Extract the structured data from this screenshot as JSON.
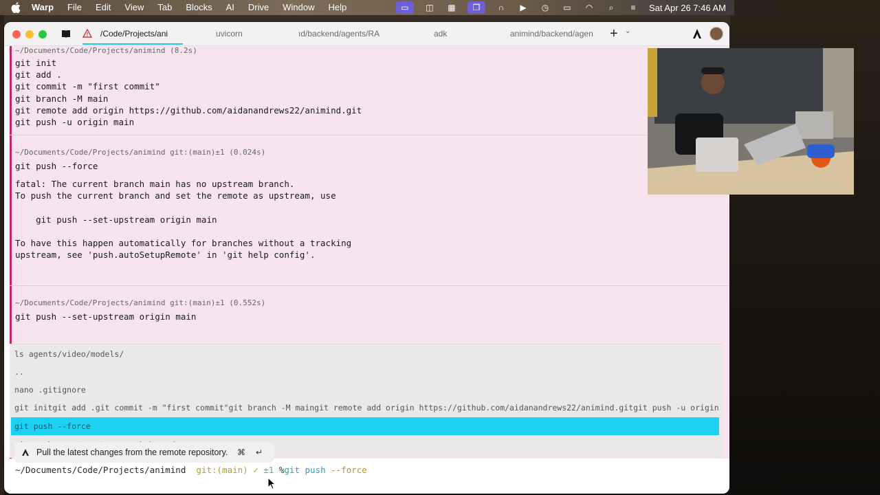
{
  "menubar": {
    "app_name": "Warp",
    "menus": [
      "File",
      "Edit",
      "View",
      "Tab",
      "Blocks",
      "AI",
      "Drive",
      "Window",
      "Help"
    ],
    "clock": "Sat Apr 26  7:46 AM"
  },
  "tabs": [
    {
      "label": "/Code/Projects/ani",
      "active": true
    },
    {
      "label": "uvicorn",
      "active": false
    },
    {
      "label": "ıd/backend/agents/RA",
      "active": false
    },
    {
      "label": "adk",
      "active": false
    },
    {
      "label": "animind/backend/agen",
      "active": false
    }
  ],
  "blocks": [
    {
      "header": "~/Documents/Code/Projects/animind (8.2s)",
      "lines": [
        "git init",
        "git add .",
        "git commit -m \"first commit\"",
        "git branch -M main",
        "git remote add origin https://github.com/aidanandrews22/animind.git",
        "git push -u origin main"
      ]
    },
    {
      "header": "~/Documents/Code/Projects/animind git:(main)±1 (0.024s)",
      "command": "git push --force",
      "output": [
        "fatal: The current branch main has no upstream branch.",
        "To push the current branch and set the remote as upstream, use",
        "    git push --set-upstream origin main",
        "To have this happen automatically for branches without a tracking",
        "upstream, see 'push.autoSetupRemote' in 'git help config'."
      ]
    },
    {
      "header": "~/Documents/Code/Projects/animind git:(main)±1 (0.552s)",
      "command": "git push --set-upstream origin main"
    }
  ],
  "history": [
    "ls agents/video/models/",
    "..",
    "nano .gitignore",
    "git initgit add .git commit -m \"first commit\"git branch -M maingit remote add origin https://github.com/aidanandrews22/animind.gitgit push -u origin main",
    "git push --force",
    "git push --set-upstream origin main"
  ],
  "history_selected_index": 4,
  "ai_hint": {
    "text": "Pull the latest changes from the remote repository.",
    "key1": "⌘",
    "key2": "↵"
  },
  "prompt": {
    "dir": "~/Documents/Code/Projects/animind",
    "git": "git:(main)",
    "check": "✓",
    "pm": "±1",
    "symbol": "%",
    "cmd": "git push",
    "flag": "--force"
  },
  "colors": {
    "block_bg": "#f7e4ef",
    "accent_bar": "#c9236e",
    "selected_history": "#1dd1f2"
  }
}
